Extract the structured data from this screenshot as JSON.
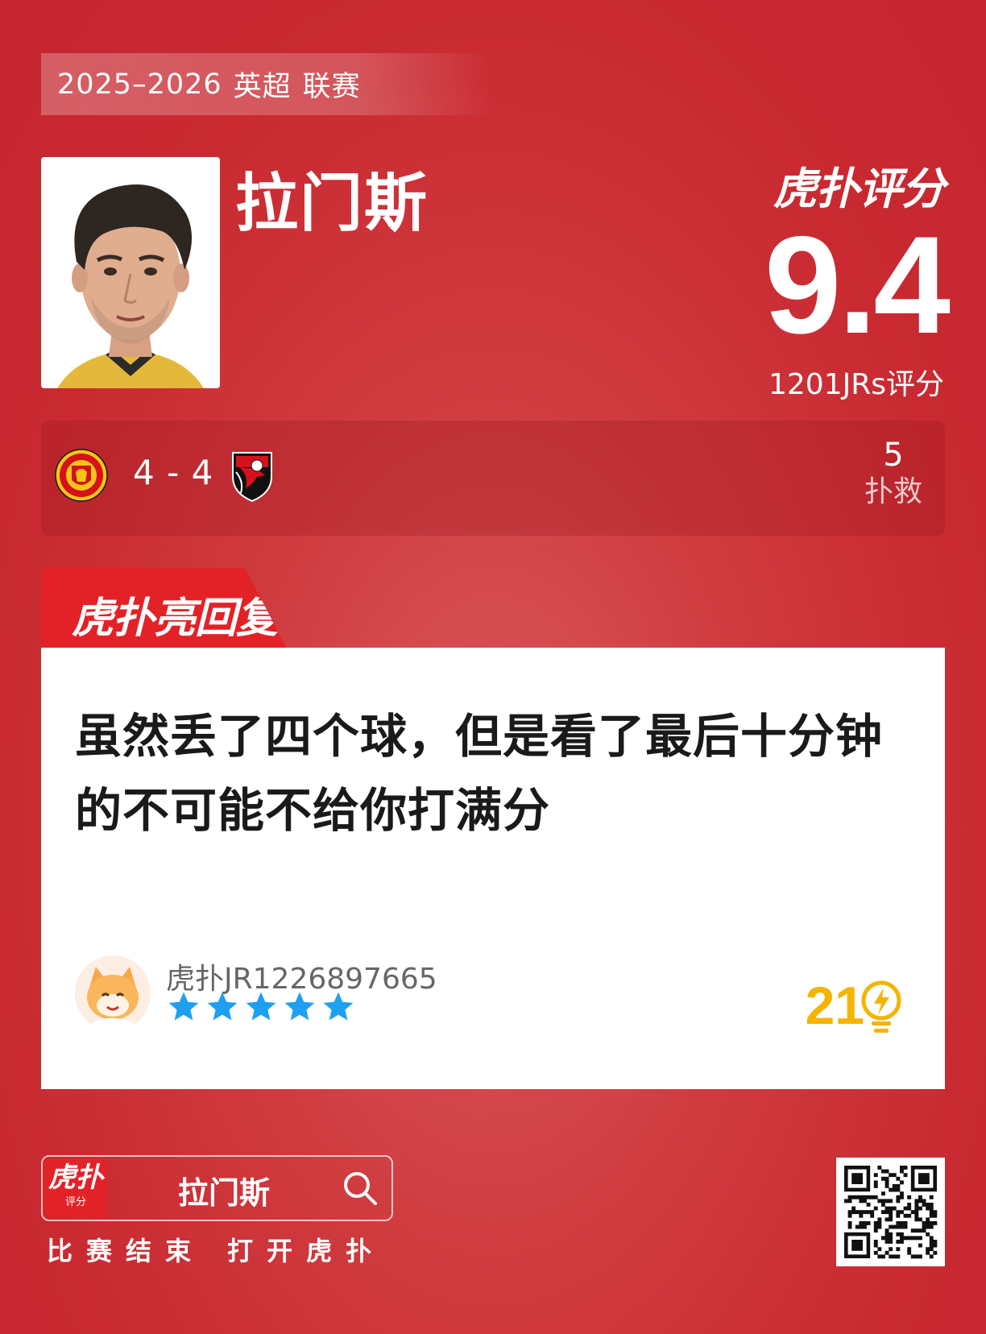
{
  "season": {
    "year": "2025–2026",
    "league": "英超",
    "stage": "联赛"
  },
  "player": {
    "name": "拉门斯",
    "photo_alt": "player-photo"
  },
  "brand": {
    "logo_text": "虎扑评分",
    "logo_jr": "JR"
  },
  "rating": {
    "score": "9.4",
    "count_label": "1201JRs评分"
  },
  "match": {
    "home_team": "Manchester United",
    "away_team": "AFC Bournemouth",
    "score": "4 - 4",
    "stat_value": "5",
    "stat_label": "扑救"
  },
  "reply": {
    "tab_label": "虎扑亮回复",
    "tab_jr": "JR",
    "comment": "虽然丢了四个球，但是看了最后十分钟的不可能不给你打满分",
    "username": "虎扑JR1226897665",
    "stars": 5,
    "likes": "21"
  },
  "footer": {
    "search_logo_main": "虎扑",
    "search_logo_sub": "评分",
    "search_text": "拉门斯",
    "caption": "比赛结束 打开虎扑"
  },
  "colors": {
    "accent_red": "#e32228",
    "like_yellow": "#f5b400",
    "star_blue": "#1ea0f0"
  },
  "icons": {
    "search": "search-icon",
    "like": "lightbulb-icon",
    "star": "star-icon",
    "qr": "qr-code"
  }
}
